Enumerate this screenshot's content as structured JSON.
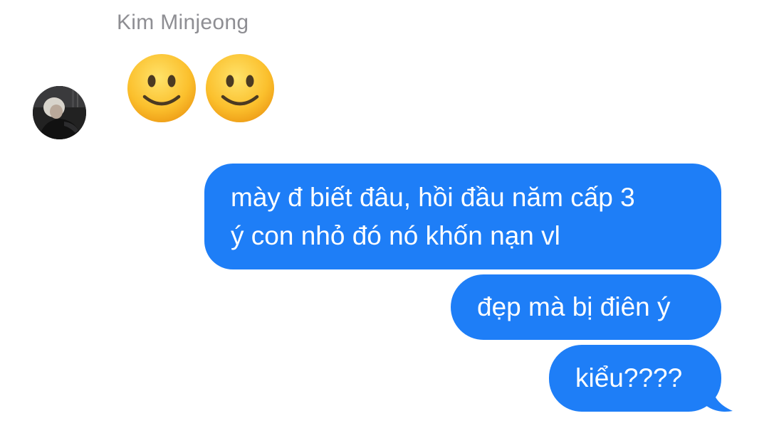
{
  "conversation": {
    "sender_name": "Kim Minjeong",
    "received": {
      "emojis": [
        "slightly-smiling-face-emoji",
        "slightly-smiling-face-emoji"
      ]
    },
    "sent_messages": [
      {
        "lines": [
          "mày đ biết đâu, hồi đầu năm cấp 3",
          "ý con nhỏ đó nó khốn nạn vl"
        ]
      },
      {
        "lines": [
          "đẹp mà bị điên ý"
        ]
      },
      {
        "lines": [
          "kiểu????"
        ]
      }
    ]
  },
  "colors": {
    "sent_bubble": "#1e7ef7",
    "sender_name": "#8e8e93",
    "background": "#ffffff"
  }
}
